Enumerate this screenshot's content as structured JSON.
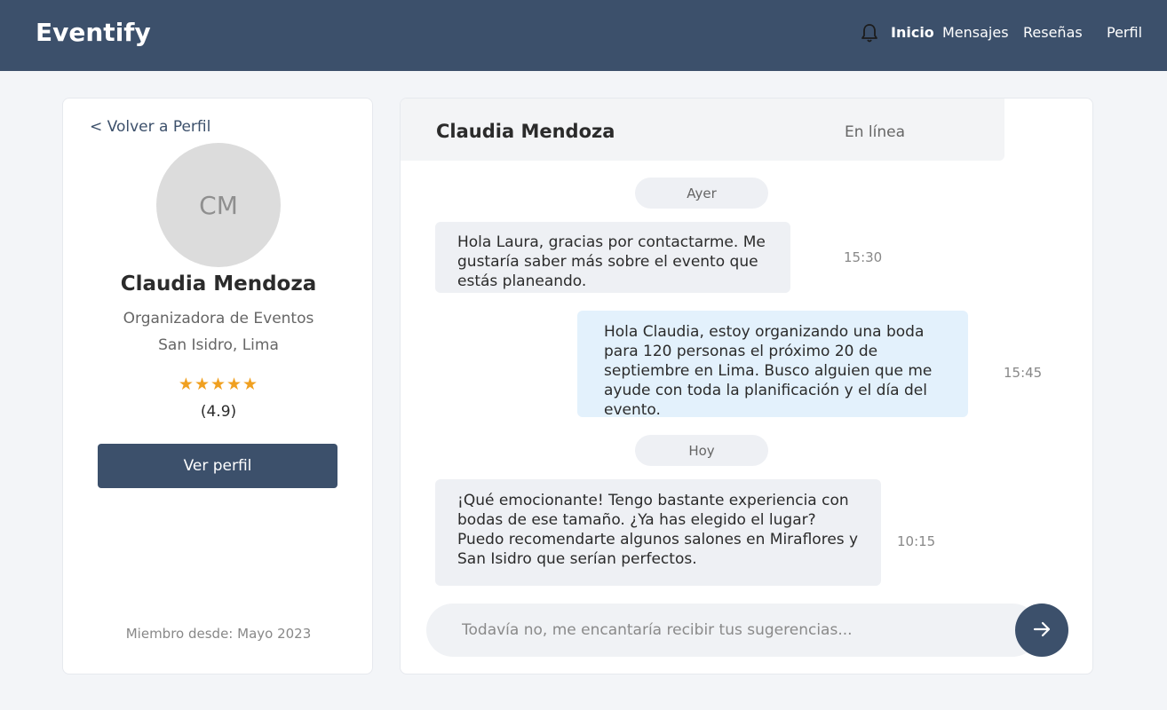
{
  "header": {
    "brand": "Eventify",
    "notification_icon": "bell-icon",
    "nav": [
      "Inicio",
      "Mensajes",
      "Reseñas",
      "Perfil"
    ],
    "active_nav": "Inicio"
  },
  "profile": {
    "back_label": "< Volver a Perfil",
    "initials": "CM",
    "name": "Claudia Mendoza",
    "role": "Organizadora de Eventos",
    "location": "San Isidro, Lima",
    "stars": "★★★★★",
    "rating": "(4.9)",
    "button_label": "Ver perfil",
    "member_since": "Miembro desde: Mayo 2023"
  },
  "chat": {
    "contact_name": "Claudia Mendoza",
    "status": "En línea",
    "days": [
      "Ayer",
      "Hoy"
    ],
    "messages": [
      {
        "direction": "in",
        "text": "Hola Laura, gracias por contactarme. Me gustaría saber más sobre el evento que estás planeando.",
        "time": "15:30"
      },
      {
        "direction": "out",
        "text": "Hola Claudia, estoy organizando una boda para 120 personas el próximo 20 de septiembre en Lima. Busco alguien que me ayude con toda la planificación y el día del evento.",
        "time": "15:45"
      },
      {
        "direction": "in",
        "text": "¡Qué emocionante! Tengo bastante experiencia con bodas de ese tamaño. ¿Ya has elegido el lugar? Puedo recomendarte algunos salones en Miraflores y San Isidro que serían perfectos.",
        "time": "10:15"
      }
    ],
    "input_placeholder": "Todavía no, me encantaría recibir tus sugerencias...",
    "send_icon": "arrow-right-icon"
  },
  "colors": {
    "primary": "#3c506b",
    "background": "#f3f5f8",
    "incoming_bubble": "#eef0f4",
    "outgoing_bubble": "#e3f1fc",
    "star": "#f0a020"
  }
}
